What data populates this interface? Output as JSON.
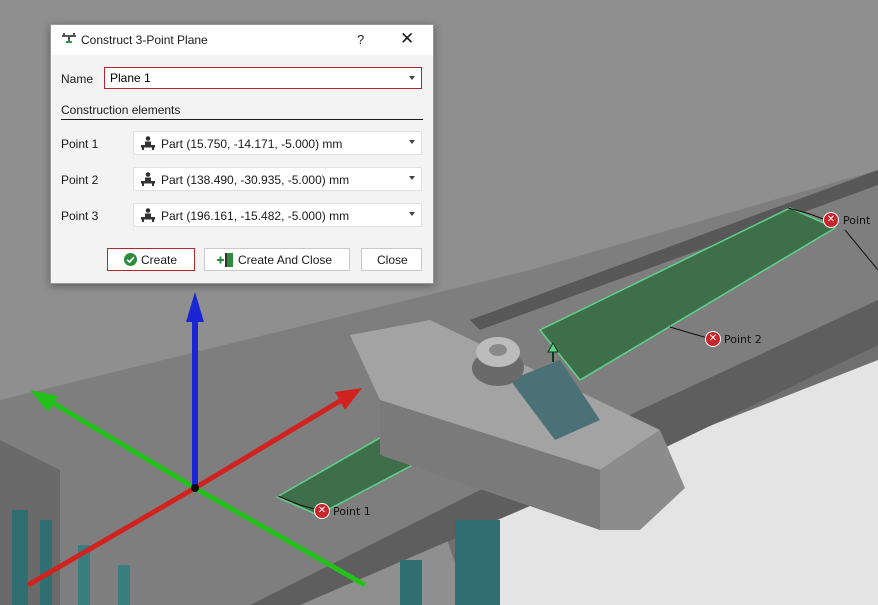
{
  "dialog": {
    "title": "Construct 3-Point Plane",
    "help_label": "?",
    "close_label": "✕",
    "name_label": "Name",
    "name_value": "Plane 1",
    "section_label": "Construction elements",
    "points": [
      {
        "label": "Point 1",
        "value": "Part (15.750, -14.171, -5.000) mm"
      },
      {
        "label": "Point 2",
        "value": "Part (138.490, -30.935, -5.000) mm"
      },
      {
        "label": "Point 3",
        "value": "Part (196.161, -15.482, -5.000) mm"
      }
    ],
    "buttons": {
      "create": "Create",
      "create_and_close": "Create And Close",
      "close": "Close"
    }
  },
  "viewport": {
    "point_markers": [
      {
        "label": "Point 1"
      },
      {
        "label": "Point 2"
      },
      {
        "label": "Point"
      }
    ],
    "colors": {
      "background": "#8f8f8f",
      "part_gray": "#7d7d7d",
      "plane_fill": "#3f6e4a",
      "plane_edge": "#5fd28a",
      "x_axis": "#d0231f",
      "y_axis": "#22c21b",
      "z_axis": "#1a25d4",
      "teal_fins": "#2f6f72",
      "marker_red": "#c8262a",
      "accent_red": "#b3262a"
    }
  }
}
